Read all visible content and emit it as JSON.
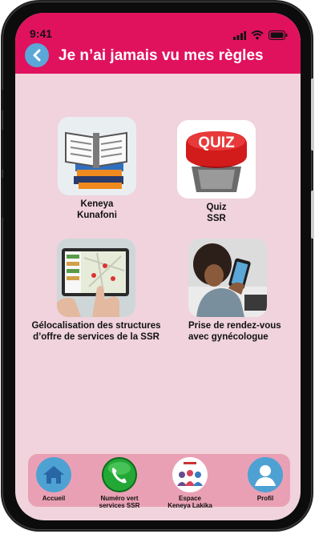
{
  "status": {
    "time": "9:41"
  },
  "header": {
    "title": "Je n’ai jamais vu mes règles"
  },
  "cards": [
    {
      "label_line1": "Keneya",
      "label_line2": "Kunafoni",
      "icon": "open-book-icon"
    },
    {
      "label_line1": "Quiz",
      "label_line2": "SSR",
      "icon": "quiz-button-icon",
      "quiz_text": "QUIZ"
    },
    {
      "label_line1": "Gélocalisation des structures",
      "label_line2": "d’offre de services de la SSR",
      "icon": "map-tablet-icon"
    },
    {
      "label_line1": "Prise de rendez-vous",
      "label_line2": "avec gynécologue",
      "icon": "phone-user-icon"
    }
  ],
  "bottom_nav": [
    {
      "label_line1": "Accueil",
      "label_line2": "",
      "icon": "home-icon"
    },
    {
      "label_line1": "Numéro vert",
      "label_line2": "services SSR",
      "icon": "phone-icon"
    },
    {
      "label_line1": "Espace",
      "label_line2": "Keneya Lakika",
      "icon": "community-icon"
    },
    {
      "label_line1": "Profil",
      "label_line2": "",
      "icon": "user-icon"
    }
  ],
  "colors": {
    "header": "#e0125e",
    "background": "#f0d3dc",
    "nav_bar": "#e9a0b5",
    "accent_blue": "#5aa7d8"
  }
}
